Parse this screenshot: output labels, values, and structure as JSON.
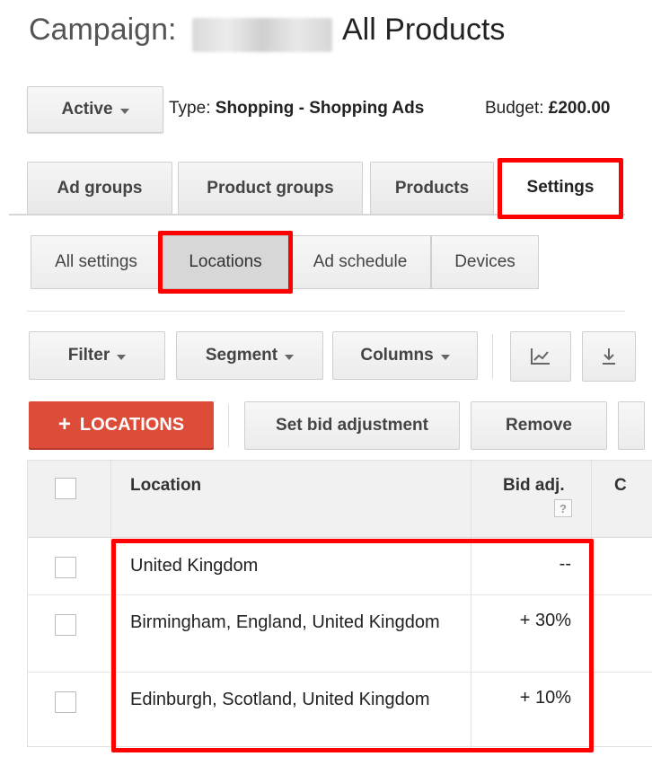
{
  "header": {
    "title_prefix": "Campaign:",
    "title_name": "All Products"
  },
  "status": {
    "label": "Active"
  },
  "meta": {
    "type_label": "Type:",
    "type_value": "Shopping - Shopping Ads",
    "budget_label": "Budget:",
    "budget_value": "£200.00"
  },
  "tabs": [
    {
      "label": "Ad groups"
    },
    {
      "label": "Product groups"
    },
    {
      "label": "Products"
    },
    {
      "label": "Settings",
      "active": true
    }
  ],
  "subtabs": [
    {
      "label": "All settings"
    },
    {
      "label": "Locations",
      "active": true
    },
    {
      "label": "Ad schedule"
    },
    {
      "label": "Devices"
    }
  ],
  "toolbar": {
    "filter_label": "Filter",
    "segment_label": "Segment",
    "columns_label": "Columns",
    "chart_icon": "line-chart-icon",
    "download_icon": "download-icon"
  },
  "actions": {
    "add_label": "LOCATIONS",
    "bid_adjust_label": "Set bid adjustment",
    "remove_label": "Remove"
  },
  "table": {
    "headers": {
      "location": "Location",
      "bid": "Bid adj.",
      "help": "?",
      "next": "C"
    },
    "rows": [
      {
        "location": "United Kingdom",
        "bid": "--"
      },
      {
        "location": "Birmingham, England, United Kingdom",
        "bid": "+ 30%"
      },
      {
        "location": "Edinburgh, Scotland, United Kingdom",
        "bid": "+ 10%"
      }
    ]
  },
  "colors": {
    "accent_red": "#dd4b39",
    "highlight": "#ff0000"
  }
}
